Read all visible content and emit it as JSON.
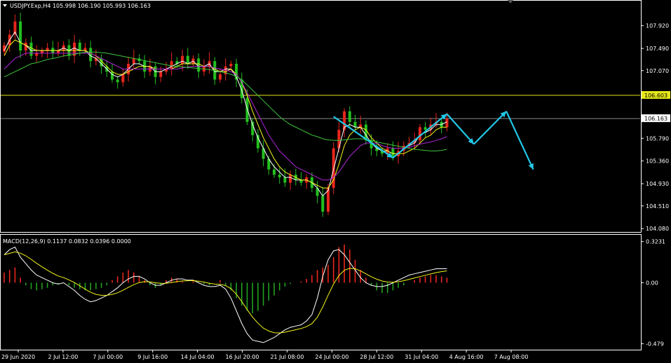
{
  "window": {
    "main_title": "USDJPY.Exp,H4  105.998 106.190 105.993 106.163",
    "macd_title": "MACD(12,26,9) 0.1137 0.0832 0.0396 0.0000"
  },
  "colors": {
    "background": "#000000",
    "frame": "#ffffff",
    "bull_candle": "#e8261c",
    "bear_candle": "#22c01e",
    "sma_fast": "#ffffff",
    "sma_mid": "#f4f41a",
    "sma_slow_purple": "#b026d8",
    "sma_slow_green": "#3cc43c",
    "hline": "#e6e61a",
    "arrow": "#21c8e6",
    "hist_pos": "#e8261c",
    "hist_neg": "#22a020",
    "macd_line": "#ffffff",
    "signal_line": "#f4f41a"
  },
  "chart_data": [
    {
      "type": "candlestick",
      "title": "USDJPY.Exp,H4",
      "ohlc_last": {
        "open": 105.998,
        "high": 106.19,
        "low": 105.993,
        "close": 106.163
      },
      "x_tick_labels": [
        "29 Jun 2020",
        "2 Jul 12:00",
        "7 Jul 00:00",
        "9 Jul 16:00",
        "14 Jul 04:00",
        "16 Jul 20:00",
        "21 Jul 08:00",
        "24 Jul 00:00",
        "28 Jul 12:00",
        "31 Jul 04:00",
        "4 Aug 16:00",
        "7 Aug 08:00"
      ],
      "y_tick_labels": [
        "107.920",
        "107.490",
        "107.070",
        "106.603",
        "106.163",
        "105.790",
        "105.360",
        "104.930",
        "104.510",
        "104.080"
      ],
      "ylim": [
        104.03,
        108.38
      ],
      "price_line": 106.163,
      "horizontal_level": 106.603,
      "series_close": [
        107.55,
        107.75,
        108.0,
        107.45,
        107.6,
        107.35,
        107.4,
        107.45,
        107.5,
        107.4,
        107.45,
        107.55,
        107.35,
        107.6,
        107.45,
        107.5,
        107.25,
        107.3,
        107.15,
        107.05,
        106.9,
        106.85,
        107.0,
        107.2,
        107.3,
        107.25,
        107.05,
        107.15,
        106.95,
        107.05,
        107.1,
        107.25,
        107.2,
        107.35,
        107.2,
        107.3,
        107.05,
        107.15,
        107.25,
        106.9,
        107.0,
        107.15,
        107.2,
        106.9,
        106.55,
        106.1,
        105.85,
        105.6,
        105.4,
        105.2,
        105.1,
        105.05,
        104.95,
        105.1,
        105.0,
        104.95,
        105.05,
        104.85,
        104.7,
        104.4,
        104.85,
        105.6,
        105.95,
        106.3,
        106.1,
        106.0,
        106.05,
        105.75,
        105.6,
        105.55,
        105.5,
        105.6,
        105.45,
        105.55,
        105.65,
        105.7,
        105.75,
        106.0,
        105.95,
        106.05,
        106.1,
        106.0,
        106.16
      ],
      "overlay_series": [
        {
          "color": "white",
          "values": [
            107.45,
            107.65,
            107.8,
            107.6,
            107.55,
            107.45,
            107.45,
            107.45,
            107.45,
            107.45,
            107.45,
            107.5,
            107.45,
            107.5,
            107.45,
            107.45,
            107.35,
            107.3,
            107.2,
            107.1,
            107.0,
            106.95,
            107.0,
            107.1,
            107.2,
            107.2,
            107.15,
            107.15,
            107.05,
            107.05,
            107.1,
            107.15,
            107.2,
            107.25,
            107.2,
            107.25,
            107.15,
            107.15,
            107.2,
            107.05,
            107.05,
            107.1,
            107.1,
            106.95,
            106.7,
            106.35,
            106.05,
            105.8,
            105.6,
            105.4,
            105.25,
            105.15,
            105.05,
            105.05,
            105.0,
            105.0,
            105.0,
            104.95,
            104.85,
            104.7,
            104.8,
            105.2,
            105.6,
            106.0,
            106.05,
            106.0,
            106.0,
            105.85,
            105.7,
            105.6,
            105.55,
            105.55,
            105.5,
            105.5,
            105.6,
            105.65,
            105.7,
            105.85,
            105.9,
            105.95,
            106.05,
            106.05,
            106.1
          ]
        },
        {
          "color": "yellow",
          "values": [
            107.35,
            107.55,
            107.65,
            107.6,
            107.55,
            107.5,
            107.45,
            107.45,
            107.45,
            107.45,
            107.45,
            107.45,
            107.45,
            107.45,
            107.45,
            107.45,
            107.4,
            107.35,
            107.25,
            107.15,
            107.05,
            107.0,
            107.0,
            107.05,
            107.1,
            107.15,
            107.15,
            107.15,
            107.1,
            107.1,
            107.1,
            107.1,
            107.15,
            107.2,
            107.2,
            107.2,
            107.2,
            107.15,
            107.15,
            107.1,
            107.05,
            107.05,
            107.1,
            107.0,
            106.85,
            106.6,
            106.3,
            106.05,
            105.8,
            105.6,
            105.4,
            105.25,
            105.15,
            105.1,
            105.05,
            105.0,
            105.0,
            104.95,
            104.9,
            104.85,
            104.85,
            105.0,
            105.3,
            105.65,
            105.85,
            105.95,
            106.0,
            105.95,
            105.8,
            105.7,
            105.6,
            105.55,
            105.5,
            105.5,
            105.5,
            105.55,
            105.6,
            105.7,
            105.8,
            105.85,
            105.95,
            106.0,
            106.0
          ]
        },
        {
          "color": "purple",
          "values": [
            107.1,
            107.2,
            107.3,
            107.35,
            107.4,
            107.4,
            107.4,
            107.4,
            107.4,
            107.4,
            107.4,
            107.4,
            107.4,
            107.4,
            107.4,
            107.4,
            107.4,
            107.35,
            107.3,
            107.25,
            107.2,
            107.15,
            107.1,
            107.1,
            107.1,
            107.1,
            107.1,
            107.1,
            107.1,
            107.1,
            107.1,
            107.1,
            107.1,
            107.12,
            107.14,
            107.15,
            107.15,
            107.15,
            107.15,
            107.12,
            107.1,
            107.08,
            107.05,
            107.0,
            106.85,
            106.65,
            106.45,
            106.25,
            106.05,
            105.85,
            105.7,
            105.55,
            105.45,
            105.35,
            105.25,
            105.2,
            105.15,
            105.1,
            105.05,
            105.0,
            105.0,
            105.05,
            105.15,
            105.3,
            105.45,
            105.55,
            105.65,
            105.7,
            105.7,
            105.7,
            105.65,
            105.62,
            105.6,
            105.6,
            105.6,
            105.62,
            105.65,
            105.68,
            105.7,
            105.72,
            105.75,
            105.78,
            105.82
          ]
        },
        {
          "color": "green",
          "values": [
            106.95,
            107.0,
            107.05,
            107.1,
            107.15,
            107.2,
            107.22,
            107.25,
            107.28,
            107.3,
            107.32,
            107.35,
            107.36,
            107.38,
            107.4,
            107.42,
            107.42,
            107.42,
            107.41,
            107.4,
            107.38,
            107.36,
            107.34,
            107.32,
            107.3,
            107.28,
            107.26,
            107.24,
            107.22,
            107.2,
            107.18,
            107.16,
            107.15,
            107.14,
            107.13,
            107.12,
            107.11,
            107.1,
            107.09,
            107.07,
            107.05,
            107.03,
            107.0,
            106.96,
            106.9,
            106.8,
            106.7,
            106.6,
            106.5,
            106.4,
            106.3,
            106.2,
            106.12,
            106.05,
            106.0,
            105.95,
            105.9,
            105.85,
            105.82,
            105.78,
            105.76,
            105.75,
            105.75,
            105.76,
            105.77,
            105.78,
            105.78,
            105.77,
            105.75,
            105.72,
            105.7,
            105.68,
            105.66,
            105.64,
            105.62,
            105.6,
            105.58,
            105.57,
            105.56,
            105.55,
            105.55,
            105.56,
            105.58
          ]
        }
      ],
      "forecast_zigzag": [
        {
          "index": 61,
          "price": 106.2
        },
        {
          "index": 72,
          "price": 105.42
        },
        {
          "index": 82,
          "price": 106.25
        },
        {
          "index": 87,
          "price": 105.68
        },
        {
          "index": 93,
          "price": 106.3
        },
        {
          "index": 98,
          "price": 105.2
        }
      ]
    },
    {
      "type": "macd",
      "title": "MACD(12,26,9)",
      "params": [
        12,
        26,
        9
      ],
      "readout": {
        "macd": 0.1137,
        "signal": 0.0832,
        "histogram": 0.0396,
        "zero": 0.0
      },
      "y_tick_labels": [
        "0.3231",
        "0.00",
        "-0.479"
      ],
      "ylim": [
        -0.52,
        0.36
      ],
      "histogram": [
        0.08,
        0.1,
        0.12,
        0.04,
        -0.02,
        -0.05,
        -0.06,
        -0.05,
        -0.04,
        -0.02,
        -0.01,
        0.0,
        -0.02,
        -0.04,
        -0.05,
        -0.06,
        -0.06,
        -0.05,
        -0.04,
        -0.02,
        0.02,
        0.05,
        0.08,
        0.1,
        0.08,
        0.05,
        0.02,
        -0.02,
        -0.04,
        -0.02,
        0.02,
        0.04,
        0.03,
        0.01,
        0.0,
        0.02,
        0.0,
        -0.01,
        -0.02,
        0.0,
        0.02,
        -0.02,
        -0.06,
        -0.12,
        -0.18,
        -0.22,
        -0.24,
        -0.22,
        -0.18,
        -0.14,
        -0.1,
        -0.06,
        -0.03,
        -0.01,
        0.0,
        0.01,
        0.03,
        0.06,
        0.1,
        0.12,
        0.14,
        0.2,
        0.28,
        0.3,
        0.26,
        0.18,
        0.1,
        0.04,
        -0.02,
        -0.06,
        -0.08,
        -0.08,
        -0.06,
        -0.04,
        -0.02,
        0.0,
        0.02,
        0.04,
        0.05,
        0.06,
        0.06,
        0.05,
        0.04
      ],
      "macd_line": [
        0.22,
        0.26,
        0.28,
        0.2,
        0.15,
        0.1,
        0.06,
        0.04,
        0.02,
        0.0,
        -0.01,
        0.0,
        -0.03,
        -0.06,
        -0.1,
        -0.13,
        -0.15,
        -0.14,
        -0.12,
        -0.1,
        -0.07,
        -0.04,
        0.0,
        0.03,
        0.05,
        0.05,
        0.03,
        0.0,
        -0.02,
        -0.02,
        0.0,
        0.02,
        0.03,
        0.03,
        0.02,
        0.02,
        0.0,
        -0.02,
        -0.03,
        -0.03,
        -0.02,
        -0.05,
        -0.12,
        -0.22,
        -0.32,
        -0.4,
        -0.45,
        -0.46,
        -0.47,
        -0.45,
        -0.43,
        -0.4,
        -0.37,
        -0.35,
        -0.34,
        -0.33,
        -0.3,
        -0.25,
        -0.12,
        0.05,
        0.18,
        0.25,
        0.26,
        0.22,
        0.16,
        0.1,
        0.04,
        0.0,
        -0.02,
        -0.03,
        -0.03,
        -0.02,
        0.0,
        0.02,
        0.04,
        0.06,
        0.07,
        0.08,
        0.09,
        0.1,
        0.11,
        0.11,
        0.11
      ]
    }
  ]
}
